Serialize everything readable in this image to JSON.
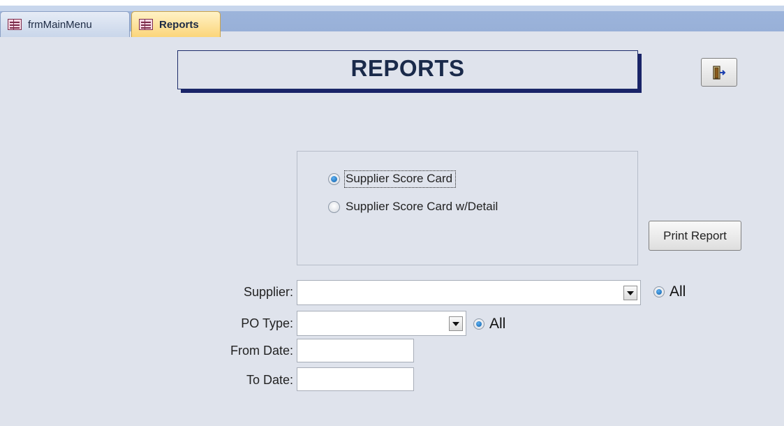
{
  "tabs": [
    {
      "label": "frmMainMenu",
      "active": false
    },
    {
      "label": "Reports",
      "active": true
    }
  ],
  "form": {
    "title": "REPORTS",
    "exit_icon": "exit-door-icon",
    "report_options": [
      {
        "label": "Supplier Score Card",
        "selected": true
      },
      {
        "label": "Supplier Score Card w/Detail",
        "selected": false
      }
    ],
    "print_button_label": "Print Report",
    "fields": {
      "supplier": {
        "label": "Supplier:",
        "value": "",
        "all_label": "All",
        "all_selected": true
      },
      "po_type": {
        "label": "PO Type:",
        "value": "",
        "all_label": "All",
        "all_selected": true
      },
      "from_date": {
        "label": "From Date:",
        "value": ""
      },
      "to_date": {
        "label": "To Date:",
        "value": ""
      }
    }
  },
  "colors": {
    "background": "#dfe3ec",
    "tab_active": "#fbd57a",
    "title_shadow": "#1a2468",
    "radio_selected": "#0c5da8"
  }
}
